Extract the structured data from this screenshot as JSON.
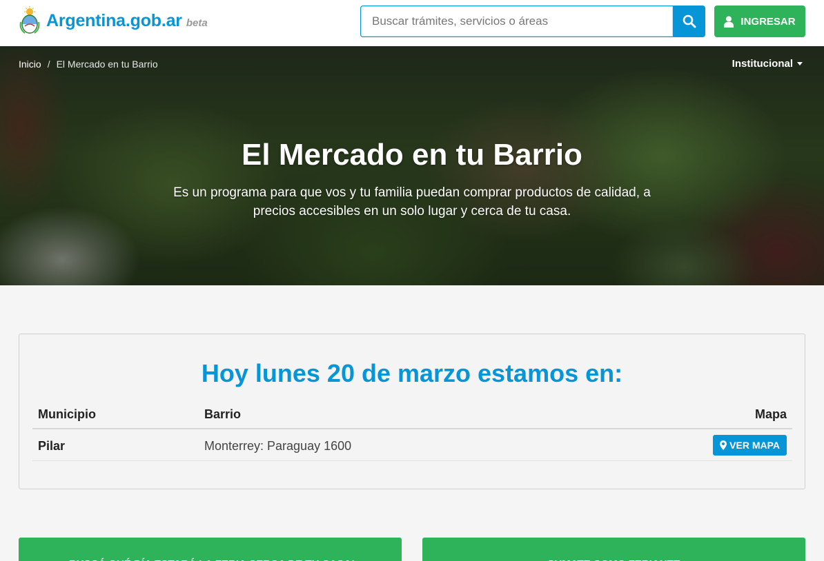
{
  "header": {
    "logo_text": "Argentina.gob.ar",
    "logo_badge": "beta",
    "search_placeholder": "Buscar trámites, servicios o áreas",
    "search_icon": "search-icon",
    "login_label": "INGRESAR",
    "login_icon": "user-icon"
  },
  "hero": {
    "breadcrumb": [
      {
        "label": "Inicio"
      },
      {
        "label": "El Mercado en tu Barrio"
      }
    ],
    "breadcrumb_separator": "/",
    "menu_label": "Institucional",
    "title": "El Mercado en tu Barrio",
    "lead_line1": "Es un programa para que vos y tu familia puedan comprar productos de calidad, a",
    "lead_line2": "precios accesibles en un solo lugar y cerca de tu casa."
  },
  "schedule": {
    "title": "Hoy lunes 20 de marzo estamos en:",
    "columns": [
      "Municipio",
      "Barrio",
      "Mapa"
    ],
    "rows": [
      {
        "municipio": "Pilar",
        "barrio": "Monterrey: Paraguay 1600",
        "map_label": "VER MAPA"
      }
    ]
  },
  "actions": {
    "find_fair": "¡BUSCÁ QUÉ DÍA ESTARÁ LA FERIA CERCA DE TU CASA!",
    "join_vendor": "SUMATE COMO FERIANTE"
  },
  "colors": {
    "brand_blue": "#0695d6",
    "brand_green": "#2eb35a"
  }
}
